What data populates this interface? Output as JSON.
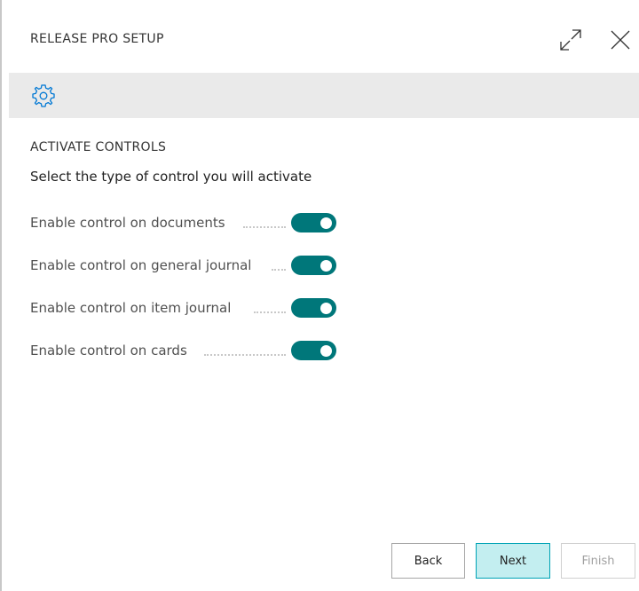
{
  "dialog": {
    "title": "RELEASE PRO SETUP",
    "expand_icon": "expand-icon",
    "close_icon": "close-icon"
  },
  "banner": {
    "icon": "gear-icon"
  },
  "section": {
    "title": "ACTIVATE CONTROLS",
    "subtitle": "Select the type of control you will activate"
  },
  "controls": [
    {
      "label": "Enable control on documents",
      "enabled": true
    },
    {
      "label": "Enable control on general journal",
      "enabled": true
    },
    {
      "label": "Enable control on item journal",
      "enabled": true
    },
    {
      "label": "Enable control on cards",
      "enabled": true
    }
  ],
  "footer": {
    "back_label": "Back",
    "next_label": "Next",
    "finish_label": "Finish"
  },
  "colors": {
    "accent": "#00777a",
    "gear": "#0078d4",
    "next_bg": "#c3eef0"
  }
}
